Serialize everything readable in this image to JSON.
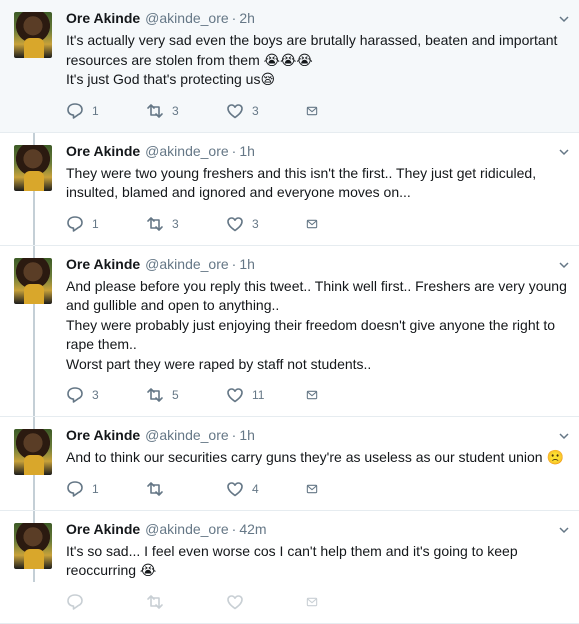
{
  "colors": {
    "text": "#14171a",
    "muted": "#657786",
    "border": "#e6ecf0",
    "highlight": "#f5f8fa",
    "thread": "#c4cfd6"
  },
  "tweets": [
    {
      "name": "Ore Akinde",
      "handle": "@akinde_ore",
      "time": "2h",
      "lines": [
        "It's actually very sad even the boys are brutally harassed, beaten and important resources are stolen from them 😭😭😭",
        "It's just God that's protecting us😪"
      ],
      "replies": "1",
      "retweets": "3",
      "likes": "3"
    },
    {
      "name": "Ore Akinde",
      "handle": "@akinde_ore",
      "time": "1h",
      "lines": [
        "They were two young freshers and this isn't the first.. They just get ridiculed, insulted, blamed and ignored and everyone moves on..."
      ],
      "replies": "1",
      "retweets": "3",
      "likes": "3"
    },
    {
      "name": "Ore Akinde",
      "handle": "@akinde_ore",
      "time": "1h",
      "lines": [
        "And please before you reply this tweet.. Think well first.. Freshers are very young and gullible and open to anything..",
        "They were probably just enjoying their freedom doesn't give anyone the right to rape them..",
        "Worst part they were raped by staff not students.."
      ],
      "replies": "3",
      "retweets": "5",
      "likes": "11"
    },
    {
      "name": "Ore Akinde",
      "handle": "@akinde_ore",
      "time": "1h",
      "lines": [
        "And to think our securities carry guns they're as useless as our student union 🙁"
      ],
      "replies": "1",
      "retweets": "",
      "likes": "4"
    },
    {
      "name": "Ore Akinde",
      "handle": "@akinde_ore",
      "time": "42m",
      "lines": [
        "It's so sad... I feel even worse cos I can't help them and it's going to keep reoccurring 😭"
      ],
      "replies": "",
      "retweets": "",
      "likes": ""
    }
  ],
  "icons": {
    "reply": "reply-icon",
    "retweet": "retweet-icon",
    "like": "heart-icon",
    "dm": "envelope-icon",
    "menu": "chevron-down-icon"
  }
}
